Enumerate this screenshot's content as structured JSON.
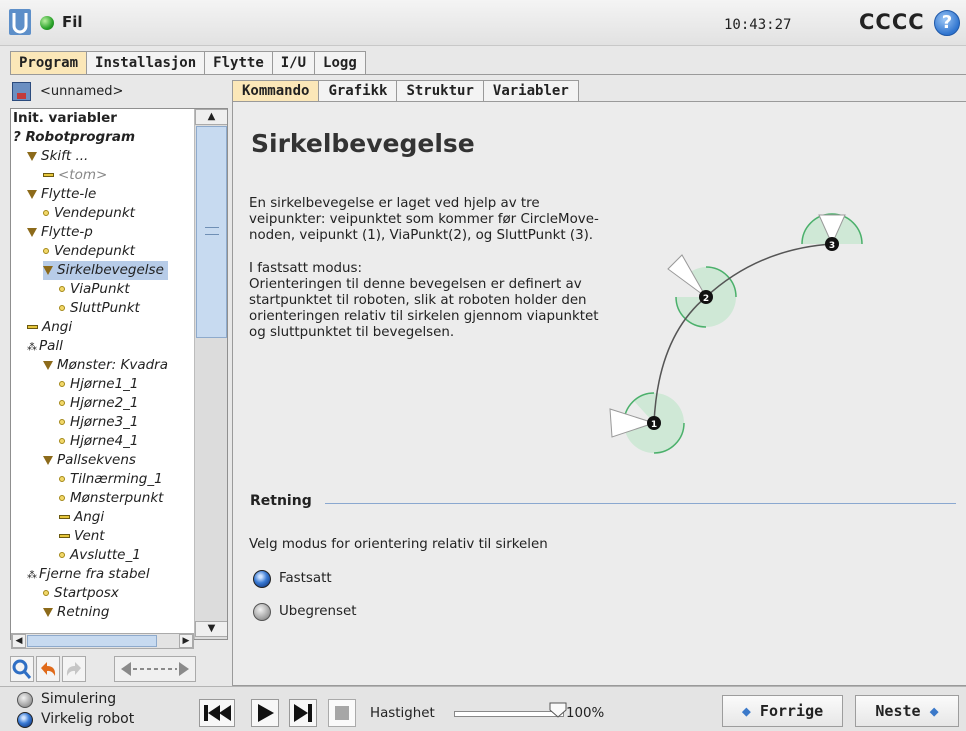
{
  "topbar": {
    "file_label": "Fil",
    "clock": "10:43:27",
    "robot_name": "CCCC",
    "help_label": "?"
  },
  "main_tabs": [
    "Program",
    "Installasjon",
    "Flytte",
    "I/U",
    "Logg"
  ],
  "program": {
    "name": "<unnamed>"
  },
  "tree": [
    {
      "label": "Init. variabler",
      "style": "bold",
      "icon": "none",
      "indent": 0
    },
    {
      "label": "Robotprogram",
      "style": "bolditalic",
      "icon": "none",
      "indent": 0,
      "prefix": "?"
    },
    {
      "label": "Skift ...",
      "style": "italic",
      "icon": "triangle",
      "indent": 1
    },
    {
      "label": "<tom>",
      "style": "muted",
      "icon": "dash",
      "indent": 2
    },
    {
      "label": "Flytte-le",
      "style": "italic",
      "icon": "triangle",
      "indent": 1
    },
    {
      "label": "Vendepunkt",
      "style": "italic",
      "icon": "dot",
      "indent": 2
    },
    {
      "label": "Flytte-p",
      "style": "italic",
      "icon": "triangle",
      "indent": 1
    },
    {
      "label": "Vendepunkt",
      "style": "italic",
      "icon": "dot",
      "indent": 2
    },
    {
      "label": "Sirkelbevegelse",
      "style": "selected",
      "icon": "triangle",
      "indent": 2
    },
    {
      "label": "ViaPunkt",
      "style": "italic",
      "icon": "dot",
      "indent": 3
    },
    {
      "label": "SluttPunkt",
      "style": "italic",
      "icon": "dot",
      "indent": 3
    },
    {
      "label": "Angi",
      "style": "italic",
      "icon": "dash",
      "indent": 1
    },
    {
      "label": "Pall",
      "style": "italic",
      "icon": "pall",
      "indent": 1
    },
    {
      "label": "Mønster: Kvadra",
      "style": "italic",
      "icon": "triangle",
      "indent": 2
    },
    {
      "label": "Hjørne1_1",
      "style": "italic",
      "icon": "dot",
      "indent": 3
    },
    {
      "label": "Hjørne2_1",
      "style": "italic",
      "icon": "dot",
      "indent": 3
    },
    {
      "label": "Hjørne3_1",
      "style": "italic",
      "icon": "dot",
      "indent": 3
    },
    {
      "label": "Hjørne4_1",
      "style": "italic",
      "icon": "dot",
      "indent": 3
    },
    {
      "label": "Pallsekvens",
      "style": "italic",
      "icon": "triangle",
      "indent": 2
    },
    {
      "label": "Tilnærming_1",
      "style": "italic",
      "icon": "dot",
      "indent": 3
    },
    {
      "label": "Mønsterpunkt",
      "style": "italic",
      "icon": "dot",
      "indent": 3
    },
    {
      "label": "Angi",
      "style": "italic",
      "icon": "dash",
      "indent": 3
    },
    {
      "label": "Vent",
      "style": "italic",
      "icon": "dash",
      "indent": 3
    },
    {
      "label": "Avslutte_1",
      "style": "italic",
      "icon": "dot",
      "indent": 3
    },
    {
      "label": "Fjerne fra stabel",
      "style": "italic",
      "icon": "pall",
      "indent": 1
    },
    {
      "label": "Startposx",
      "style": "italic",
      "icon": "dot",
      "indent": 2
    },
    {
      "label": "Retning",
      "style": "italic",
      "icon": "triangle",
      "indent": 2
    }
  ],
  "sub_tabs": [
    "Kommando",
    "Grafikk",
    "Struktur",
    "Variabler"
  ],
  "command": {
    "title": "Sirkelbevegelse",
    "description_1": "En sirkelbevegelse er laget ved hjelp av tre veipunkter: veipunktet som kommer før CircleMove-noden, veipunkt (1), ViaPunkt(2), og SluttPunkt (3).",
    "description_2": "I fastsatt modus:\nOrienteringen til denne bevegelsen er definert av startpunktet til roboten, slik at roboten holder den orienteringen relativ til sirkelen gjennom viapunktet og sluttpunktet til bevegelsen.",
    "diagram_points": [
      "1",
      "2",
      "3"
    ],
    "section_title": "Retning",
    "section_desc": "Velg modus for orientering relativ til sirkelen",
    "options": [
      {
        "label": "Fastsatt",
        "selected": true
      },
      {
        "label": "Ubegrenset",
        "selected": false
      }
    ]
  },
  "bottom": {
    "modes": [
      {
        "label": "Simulering",
        "selected": false
      },
      {
        "label": "Virkelig robot",
        "selected": true
      }
    ],
    "speed_label": "Hastighet",
    "speed_value": "100%",
    "speed_fraction": 1.0,
    "prev_label": "Forrige",
    "next_label": "Neste"
  },
  "colors": {
    "accent_tab": "#fbe7b8",
    "selection": "#b7cce8",
    "radio_on": "#3a7bd5"
  }
}
